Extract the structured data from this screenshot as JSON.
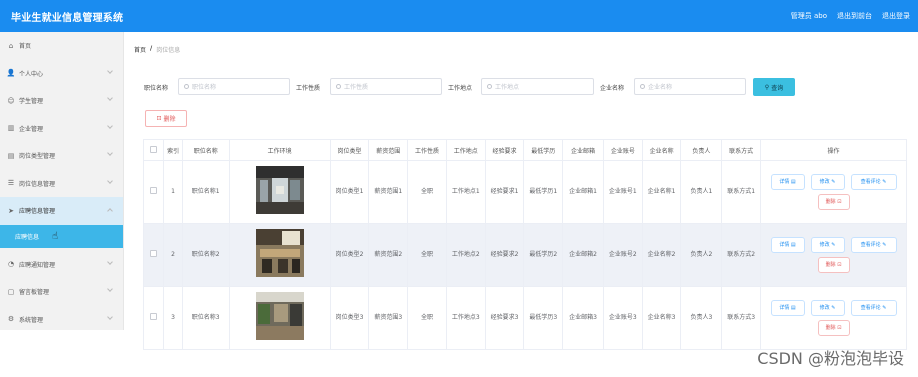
{
  "header": {
    "title": "毕业生就业信息管理系统",
    "user_label": "管理员 abo",
    "back_label": "退出到前台",
    "logout_label": "退出登录",
    "bg_color": "#1a8cf0"
  },
  "sidebar": {
    "items": [
      {
        "label": "首页",
        "icon": "home-icon",
        "glyph": "⌂"
      },
      {
        "label": "个人中心",
        "icon": "user-icon",
        "glyph": "👤"
      },
      {
        "label": "学生管理",
        "icon": "student-icon",
        "glyph": "☺"
      },
      {
        "label": "企业管理",
        "icon": "chart-icon",
        "glyph": "▥"
      },
      {
        "label": "岗位类型管理",
        "icon": "doc-icon",
        "glyph": "▤"
      },
      {
        "label": "岗位信息管理",
        "icon": "list-icon",
        "glyph": "☰"
      },
      {
        "label": "应聘信息管理",
        "icon": "send-icon",
        "glyph": "➤"
      },
      {
        "label": "应聘通知管理",
        "icon": "bell-icon",
        "glyph": "◔"
      },
      {
        "label": "留言板管理",
        "icon": "message-icon",
        "glyph": "▢"
      },
      {
        "label": "系统管理",
        "icon": "settings-icon",
        "glyph": "⚙"
      }
    ],
    "sub_item": "应聘信息",
    "active_color": "#3db6e8"
  },
  "breadcrumb": {
    "home": "首页",
    "separator": "/",
    "current": "岗位信息"
  },
  "filters": {
    "job_name_label": "职位名称",
    "job_name_placeholder": "职位名称",
    "job_nature_label": "工作性质",
    "job_nature_placeholder": "工作性质",
    "job_location_label": "工作地点",
    "job_location_placeholder": "工作地点",
    "company_label": "企业名称",
    "company_placeholder": "企业名称",
    "search_label": "查询"
  },
  "actions": {
    "delete_label": "删除"
  },
  "table": {
    "columns": [
      "索引",
      "职位名称",
      "工作环境",
      "岗位类型",
      "薪资范围",
      "工作性质",
      "工作地点",
      "经验要求",
      "最低学历",
      "企业邮箱",
      "企业账号",
      "企业名称",
      "负责人",
      "联系方式",
      "操作"
    ],
    "rows": [
      {
        "index": "1",
        "job_name": "职位名称1",
        "job_type": "岗位类型1",
        "salary": "薪资范围1",
        "nature": "全职",
        "location": "工作地点1",
        "experience": "经验要求1",
        "education": "最低学历1",
        "email": "企业邮箱1",
        "account": "企业账号1",
        "company": "企业名称1",
        "manager": "负责人1",
        "contact": "联系方式1"
      },
      {
        "index": "2",
        "job_name": "职位名称2",
        "job_type": "岗位类型2",
        "salary": "薪资范围2",
        "nature": "全职",
        "location": "工作地点2",
        "experience": "经验要求2",
        "education": "最低学历2",
        "email": "企业邮箱2",
        "account": "企业账号2",
        "company": "企业名称2",
        "manager": "负责人2",
        "contact": "联系方式2"
      },
      {
        "index": "3",
        "job_name": "职位名称3",
        "job_type": "岗位类型3",
        "salary": "薪资范围3",
        "nature": "全职",
        "location": "工作地点3",
        "experience": "经验要求3",
        "education": "最低学历3",
        "email": "企业邮箱3",
        "account": "企业账号3",
        "company": "企业名称3",
        "manager": "负责人3",
        "contact": "联系方式3"
      }
    ],
    "row_buttons": {
      "detail": "详情 ▤",
      "edit": "修改 ✎",
      "view_reviews": "查看评论 ✎",
      "delete": "删除 ⊡"
    }
  },
  "watermark": "CSDN @粉泡泡毕设"
}
